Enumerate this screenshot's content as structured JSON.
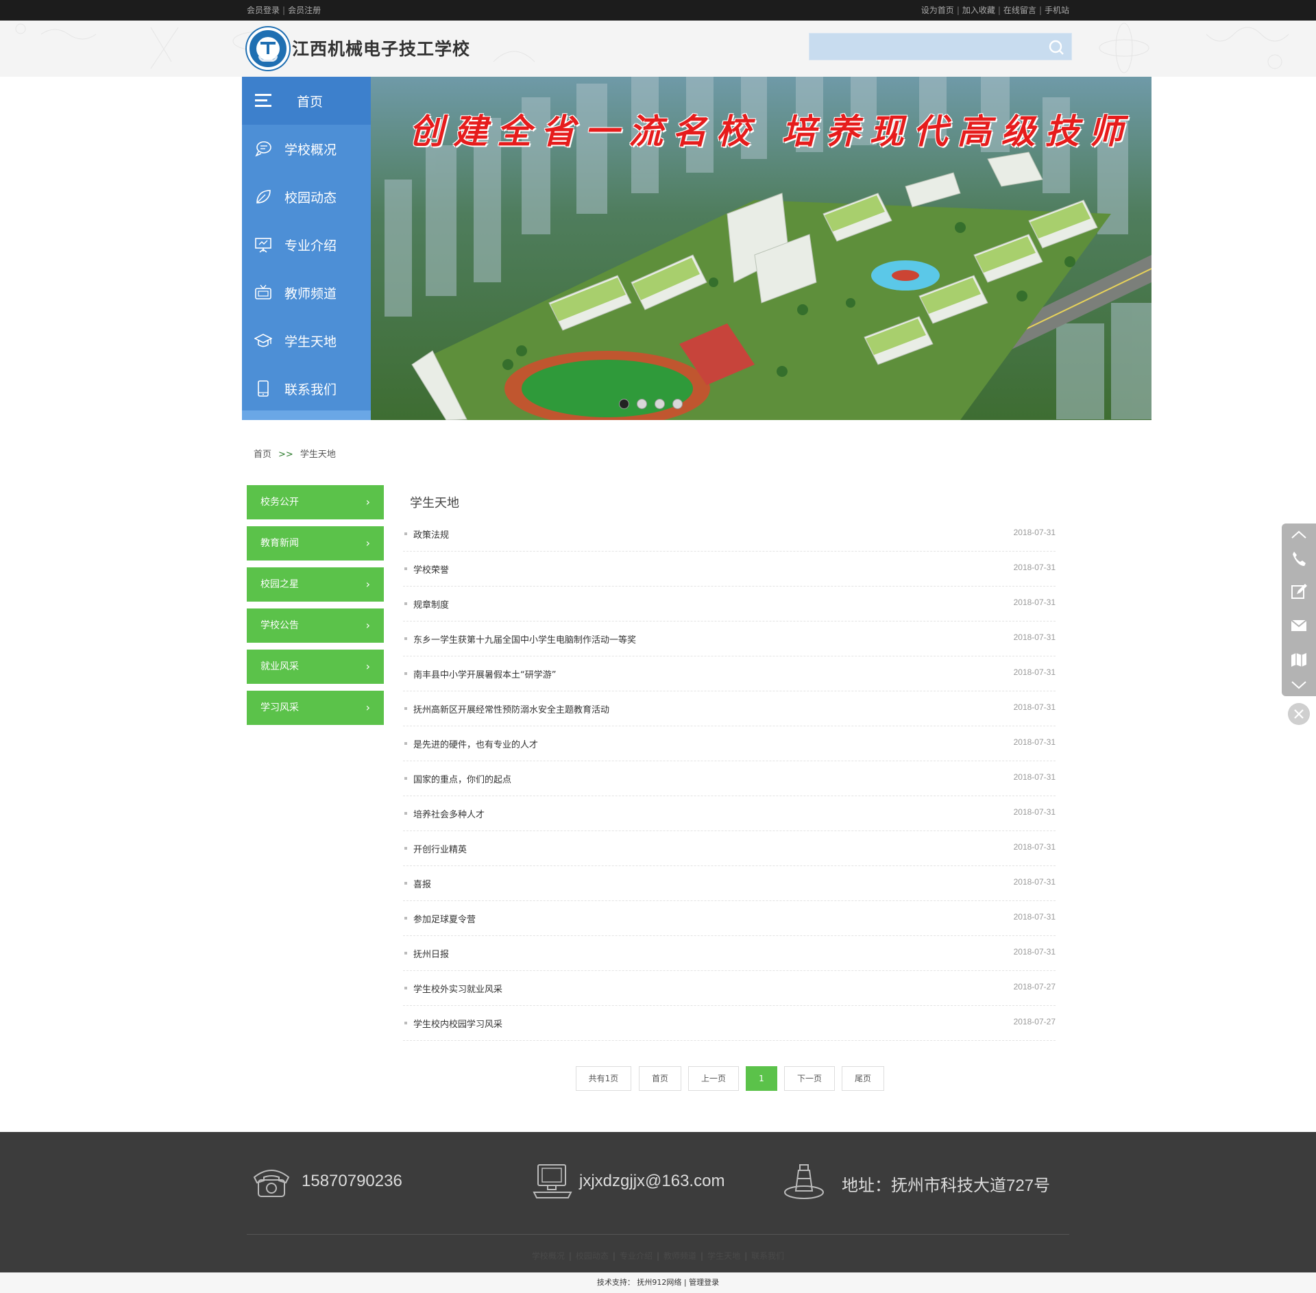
{
  "topbar": {
    "left": [
      "会员登录",
      "会员注册"
    ],
    "right": [
      "设为首页",
      "加入收藏",
      "在线留言",
      "手机站"
    ]
  },
  "header": {
    "site_title": "江西机械电子技工学校",
    "search_placeholder": ""
  },
  "nav": {
    "items": [
      {
        "label": "首页",
        "icon": "menu-icon"
      },
      {
        "label": "学校概况",
        "icon": "chat-icon"
      },
      {
        "label": "校园动态",
        "icon": "leaf-icon"
      },
      {
        "label": "专业介绍",
        "icon": "presentation-icon"
      },
      {
        "label": "教师频道",
        "icon": "tv-icon"
      },
      {
        "label": "学生天地",
        "icon": "graduation-cap-icon"
      },
      {
        "label": "联系我们",
        "icon": "phone-device-icon"
      }
    ]
  },
  "banner": {
    "slogan": "创建全省一流名校  培养现代高级技师",
    "dots": 4,
    "active_dot": 1
  },
  "breadcrumb": {
    "home": "首页",
    "separator": ">>",
    "current": "学生天地"
  },
  "sidemenu": {
    "items": [
      "校务公开",
      "教育新闻",
      "校园之星",
      "学校公告",
      "就业风采",
      "学习风采"
    ],
    "chevron": "›"
  },
  "content": {
    "title": "学生天地",
    "articles": [
      {
        "title": "政策法规",
        "date": "2018-07-31"
      },
      {
        "title": "学校荣誉",
        "date": "2018-07-31"
      },
      {
        "title": "规章制度",
        "date": "2018-07-31"
      },
      {
        "title": "东乡一学生获第十九届全国中小学生电脑制作活动一等奖",
        "date": "2018-07-31"
      },
      {
        "title": "南丰县中小学开展暑假本土“研学游”",
        "date": "2018-07-31"
      },
      {
        "title": "抚州高新区开展经常性预防溺水安全主题教育活动",
        "date": "2018-07-31"
      },
      {
        "title": "是先进的硬件，也有专业的人才",
        "date": "2018-07-31"
      },
      {
        "title": "国家的重点，你们的起点",
        "date": "2018-07-31"
      },
      {
        "title": "培养社会多种人才",
        "date": "2018-07-31"
      },
      {
        "title": "开创行业精英",
        "date": "2018-07-31"
      },
      {
        "title": "喜报",
        "date": "2018-07-31"
      },
      {
        "title": "参加足球夏令营",
        "date": "2018-07-31"
      },
      {
        "title": "抚州日报",
        "date": "2018-07-31"
      },
      {
        "title": "学生校外实习就业风采",
        "date": "2018-07-27"
      },
      {
        "title": "学生校内校园学习风采",
        "date": "2018-07-27"
      }
    ]
  },
  "pager": {
    "total": "共有1页",
    "first": "首页",
    "prev": "上一页",
    "current": "1",
    "next": "下一页",
    "last": "尾页"
  },
  "tools": [
    "arrow-up-icon",
    "phone-icon",
    "edit-icon",
    "mail-icon",
    "map-icon",
    "arrow-down-icon"
  ],
  "footer": {
    "phone": "15870790236",
    "email": "jxjxdzgjjx@163.com",
    "address": "地址：抚州市科技大道727号",
    "links": [
      "学校概况",
      "校园动态",
      "专业介绍",
      "教师频道",
      "学生天地",
      "联系我们"
    ],
    "tech_label": "技术支持：",
    "tech_vendor": "抚州912网络",
    "admin": "管理登录"
  },
  "colors": {
    "nav_blue": "#4d8fd6",
    "menu_green": "#5bc24a",
    "footer_bg": "#3c3c3c",
    "topbar_bg": "#1c1c1c"
  }
}
